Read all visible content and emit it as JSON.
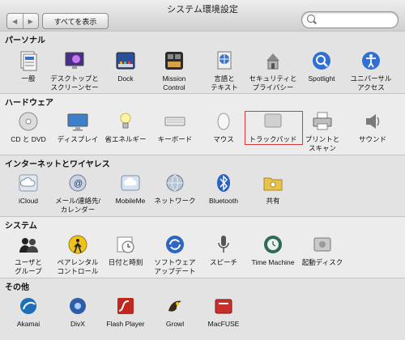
{
  "window": {
    "title": "システム環境設定"
  },
  "toolbar": {
    "back": "◀",
    "forward": "▶",
    "show_all": "すべてを表示",
    "search_placeholder": ""
  },
  "sections": [
    {
      "title": "パーソナル",
      "items": [
        {
          "label": "一般",
          "icon": "general-icon"
        },
        {
          "label": "デスクトップと\nスクリーンセーバ",
          "icon": "desktop-icon"
        },
        {
          "label": "Dock",
          "icon": "dock-icon"
        },
        {
          "label": "Mission\nControl",
          "icon": "mission-control-icon"
        },
        {
          "label": "言語と\nテキスト",
          "icon": "language-icon"
        },
        {
          "label": "セキュリティと\nプライバシー",
          "icon": "security-icon"
        },
        {
          "label": "Spotlight",
          "icon": "spotlight-icon"
        },
        {
          "label": "ユニバーサル\nアクセス",
          "icon": "universal-access-icon"
        }
      ]
    },
    {
      "title": "ハードウェア",
      "items": [
        {
          "label": "CD と DVD",
          "icon": "cd-dvd-icon"
        },
        {
          "label": "ディスプレイ",
          "icon": "display-icon"
        },
        {
          "label": "省エネルギー",
          "icon": "energy-saver-icon"
        },
        {
          "label": "キーボード",
          "icon": "keyboard-icon"
        },
        {
          "label": "マウス",
          "icon": "mouse-icon"
        },
        {
          "label": "トラックパッド",
          "icon": "trackpad-icon"
        },
        {
          "label": "プリントと\nスキャン",
          "icon": "printer-icon"
        },
        {
          "label": "サウンド",
          "icon": "sound-icon"
        }
      ]
    },
    {
      "title": "インターネットとワイヤレス",
      "items": [
        {
          "label": "iCloud",
          "icon": "icloud-icon"
        },
        {
          "label": "メール/連絡先/\nカレンダー",
          "icon": "mail-icon"
        },
        {
          "label": "MobileMe",
          "icon": "mobileme-icon"
        },
        {
          "label": "ネットワーク",
          "icon": "network-icon"
        },
        {
          "label": "Bluetooth",
          "icon": "bluetooth-icon"
        },
        {
          "label": "共有",
          "icon": "sharing-icon"
        }
      ]
    },
    {
      "title": "システム",
      "items": [
        {
          "label": "ユーザと\nグループ",
          "icon": "users-icon"
        },
        {
          "label": "ペアレンタル\nコントロール",
          "icon": "parental-icon"
        },
        {
          "label": "日付と時刻",
          "icon": "date-time-icon"
        },
        {
          "label": "ソフトウェア\nアップデート",
          "icon": "software-update-icon"
        },
        {
          "label": "スピーチ",
          "icon": "speech-icon"
        },
        {
          "label": "Time Machine",
          "icon": "time-machine-icon"
        },
        {
          "label": "起動ディスク",
          "icon": "startup-disk-icon"
        }
      ]
    },
    {
      "title": "その他",
      "items": [
        {
          "label": "Akamai",
          "icon": "akamai-icon"
        },
        {
          "label": "DivX",
          "icon": "divx-icon"
        },
        {
          "label": "Flash Player",
          "icon": "flash-icon"
        },
        {
          "label": "Growl",
          "icon": "growl-icon"
        },
        {
          "label": "MacFUSE",
          "icon": "macfuse-icon"
        }
      ]
    }
  ],
  "colors": {
    "highlight": "#d23a3a"
  }
}
